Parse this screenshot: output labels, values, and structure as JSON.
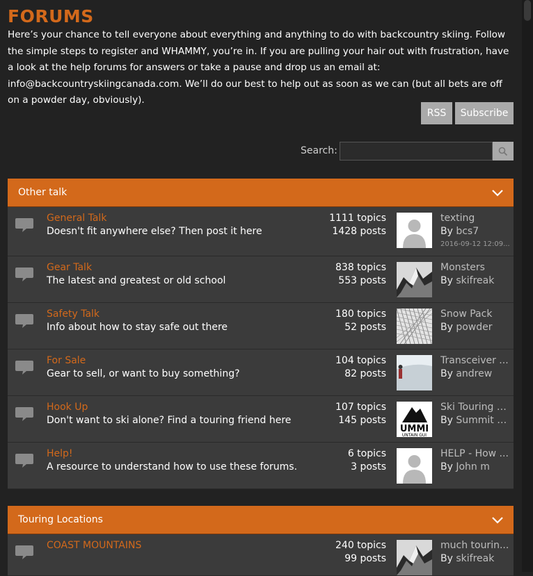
{
  "page": {
    "title": "FORUMS",
    "intro": "Here’s your chance to tell everyone about everything and anything to do with backcountry skiing. Follow the simple steps to register and WHAMMY, you’re in. If you are pulling your hair out with frustration, have a look at the help forums for answers or take a pause and drop us an email at: info@backcountryskiingcanada.com. We’ll do our best to help out as soon as we can (but all bets are off on a powder day, obviously)."
  },
  "toolbar": {
    "rss_label": "RSS",
    "subscribe_label": "Subscribe"
  },
  "search": {
    "label": "Search:",
    "placeholder": "",
    "icon": "search-icon"
  },
  "colors": {
    "accent": "#d3691b",
    "row_bg": "#3b3b3b",
    "page_bg": "#222222",
    "button_bg": "#aaaaaa"
  },
  "categories": [
    {
      "title": "Other talk",
      "toggle_icon": "chevron-down-icon",
      "forums": [
        {
          "title": "General Talk",
          "description": "Doesn't fit anywhere else? Then post it here",
          "topics": "1111 topics",
          "posts": "1428 posts",
          "last_title": "texting",
          "last_by_prefix": "By ",
          "last_by": "bcs7",
          "last_date": "2016-09-12 12:09...",
          "avatar": "default-avatar"
        },
        {
          "title": "Gear Talk",
          "description": "The latest and greatest or old school",
          "topics": "838 topics",
          "posts": "553 posts",
          "last_title": "Monsters",
          "last_by_prefix": "By ",
          "last_by": "skifreak",
          "last_date": "",
          "avatar": "mountain-photo"
        },
        {
          "title": "Safety Talk",
          "description": "Info about how to stay safe out there",
          "topics": "180 topics",
          "posts": "52 posts",
          "last_title": "Snow Pack",
          "last_by_prefix": "By ",
          "last_by": "powder",
          "last_date": "",
          "avatar": "snow-texture-photo"
        },
        {
          "title": "For Sale",
          "description": "Gear to sell, or want to buy something?",
          "topics": "104 topics",
          "posts": "82 posts",
          "last_title": "Transceiver ...",
          "last_by_prefix": "By ",
          "last_by": "andrew",
          "last_date": "",
          "avatar": "skier-photo"
        },
        {
          "title": "Hook Up",
          "description": "Don't want to ski alone? Find a touring friend here",
          "topics": "107 topics",
          "posts": "145 posts",
          "last_title": "Ski Touring G...",
          "last_by_prefix": "By ",
          "last_by": "Summit M...",
          "last_date": "",
          "avatar": "summit-logo",
          "avatar_text_top": "UMMI",
          "avatar_text_bottom": "UNTAIN GUI"
        },
        {
          "title": "Help!",
          "description": "A resource to understand how to use these forums.",
          "topics": "6 topics",
          "posts": "3 posts",
          "last_title": "HELP - How ...",
          "last_by_prefix": "By ",
          "last_by": "John m",
          "last_date": "",
          "avatar": "default-avatar"
        }
      ]
    },
    {
      "title": "Touring Locations",
      "toggle_icon": "chevron-down-icon",
      "forums": [
        {
          "title": "COAST MOUNTAINS",
          "description": "",
          "topics": "240 topics",
          "posts": "99 posts",
          "last_title": "much tourin...",
          "last_by_prefix": "By ",
          "last_by": "skifreak",
          "last_date": "",
          "avatar": "mountain-photo"
        }
      ]
    }
  ]
}
